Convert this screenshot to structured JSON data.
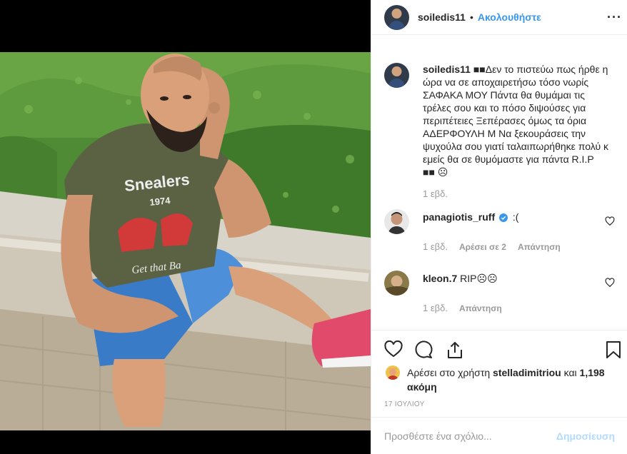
{
  "post": {
    "username": "soiledis11",
    "follow_label": "Ακολουθήστε",
    "separator": "•",
    "more_label": "···"
  },
  "caption": {
    "username": "soiledis11",
    "text": "■■Δεν το πιστεύω πως ήρθε η ώρα να σε αποχαιρετήσω τόσο νωρίς ΣΑΦΑΚΑ ΜΟΥ Πάντα θα θυμάμαι τις τρέλες σου και το πόσο διψούσες για περιπέτειες Ξεπέρασες όμως τα όρια ΑΔΕΡΦΟΥΛΗ Μ Να ξεκουράσεις την ψυχούλα σου γιατί ταλαιπωρήθηκε πολύ κ εμείς θα σε θυμόμαστε για πάντα R.I.P ■■ ☹",
    "time": "1 εβδ."
  },
  "comments": [
    {
      "username": "panagiotis_ruff",
      "verified": true,
      "text": ":(",
      "time": "1 εβδ.",
      "likes": "Αρέσει σε 2",
      "reply": "Απάντηση"
    },
    {
      "username": "kleon.7",
      "verified": false,
      "text": "RIP☹☹",
      "time": "1 εβδ.",
      "likes": "",
      "reply": "Απάντηση"
    }
  ],
  "likes": {
    "prefix": "Αρέσει στο χρήστη",
    "user": "stelladimitriou",
    "joiner": "και",
    "count": "1,198 ακόμη"
  },
  "date": "17 ΙΟΥΛΙΟΥ",
  "add_comment": {
    "placeholder": "Προσθέστε ένα σχόλιο...",
    "publish_label": "Δημοσίευση"
  },
  "icons": [
    "heart-icon",
    "comment-icon",
    "share-icon",
    "bookmark-icon",
    "verified-badge-icon",
    "more-options-icon"
  ],
  "colors": {
    "accent": "#3897f0",
    "publish_disabled": "#b3dbff",
    "meta": "#999999",
    "text": "#262626",
    "border": "#efefef"
  }
}
